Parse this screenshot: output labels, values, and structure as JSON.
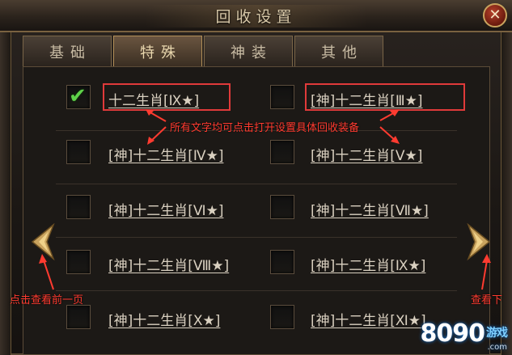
{
  "window": {
    "title": "回收设置",
    "close_label": "✕"
  },
  "tabs": [
    {
      "label": "基础",
      "active": false
    },
    {
      "label": "特殊",
      "active": true
    },
    {
      "label": "神装",
      "active": false
    },
    {
      "label": "其他",
      "active": false
    }
  ],
  "items": [
    {
      "label": "十二生肖[Ⅸ★]",
      "checked": true
    },
    {
      "label": "[神]十二生肖[Ⅲ★]",
      "checked": false
    },
    {
      "label": "[神]十二生肖[Ⅳ★]",
      "checked": false
    },
    {
      "label": "[神]十二生肖[Ⅴ★]",
      "checked": false
    },
    {
      "label": "[神]十二生肖[Ⅵ★]",
      "checked": false
    },
    {
      "label": "[神]十二生肖[Ⅶ★]",
      "checked": false
    },
    {
      "label": "[神]十二生肖[Ⅷ★]",
      "checked": false
    },
    {
      "label": "[神]十二生肖[Ⅸ★]",
      "checked": false
    },
    {
      "label": "[神]十二生肖[Ⅹ★]",
      "checked": false
    },
    {
      "label": "[神]十二生肖[Ⅺ★]",
      "checked": false
    }
  ],
  "annotations": {
    "labels_hint": "所有文字均可点击打开设置具体回收装备",
    "prev_hint": "点击查看前一页",
    "next_hint": "查看下"
  },
  "watermark": {
    "brand": "8090",
    "suffix": "游戏",
    "domain": ".com"
  },
  "colors": {
    "accent_red": "#e03a3a",
    "check_green": "#5fd14a",
    "gold": "#c9a35e"
  },
  "icons": {
    "prev": "prev-page-arrow-icon",
    "next": "next-page-arrow-icon",
    "check": "checkmark-icon",
    "close": "close-icon"
  }
}
